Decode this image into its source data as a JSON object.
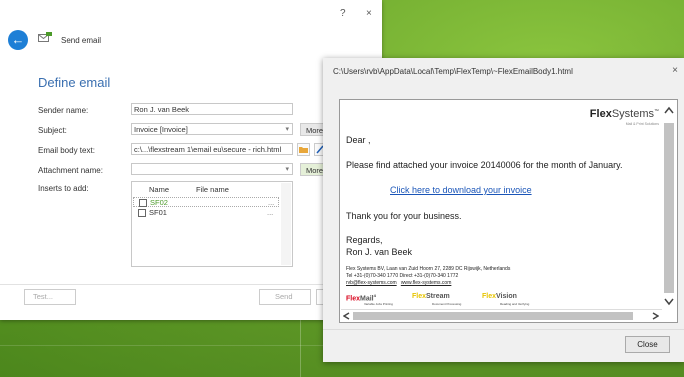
{
  "window": {
    "help": "?",
    "close": "×",
    "title": "Send email"
  },
  "form": {
    "heading": "Define email",
    "sender_label": "Sender name:",
    "sender_value": "Ron J. van Beek",
    "subject_label": "Subject:",
    "subject_value": "Invoice [Invoice]",
    "body_label": "Email body text:",
    "body_value": "c:\\...\\flexstream 1\\email eu\\secure - rich.html",
    "attach_label": "Attachment name:",
    "attach_value": "",
    "inserts_label": "Inserts to add:",
    "more_label": "More",
    "table": {
      "headers": [
        "Name",
        "File name"
      ],
      "rows": [
        {
          "name": "SF02",
          "file": "",
          "color": "#4b9a29"
        },
        {
          "name": "SF01",
          "file": "",
          "color": "#333333"
        }
      ],
      "ellipsis": "..."
    }
  },
  "footer": {
    "test": "Test...",
    "send": "Send"
  },
  "preview": {
    "title": "C:\\Users\\rvb\\AppData\\Local\\Temp\\FlexTemp\\~FlexEmailBody1.html",
    "close_x": "×",
    "logo_bold": "Flex",
    "logo_rest": "Systems",
    "logo_tm": "™",
    "logo_sub": "Mail & Print Solutions",
    "greeting": "Dear ,",
    "line1": "Please find attached your invoice 20140006 for the month of January.",
    "link": "Click here to download your invoice",
    "thanks": "Thank you for your business.",
    "regards": "Regards,",
    "signer": "Ron J. van Beek",
    "address": "Flex Systems BV, Laan van Zuid Hoorn 27, 2289 DC Rijswijk, Netherlands",
    "tel": "Tel +31-(0)70-340 1770    Direct +31-(0)70-340 1772",
    "email": "rvb@flex-systems.com",
    "web": "www.flex-systems.com",
    "brands": [
      {
        "a": "Flex",
        "b": "Mail",
        "c": "4",
        "sub": "Variable Jobs Printing"
      },
      {
        "a": "Flex",
        "b": "Stream",
        "c": "",
        "sub": "Document Processing"
      },
      {
        "a": "Flex",
        "b": "Vision",
        "c": "",
        "sub": "Reading and Verifying"
      }
    ],
    "close_button": "Close"
  },
  "colors": {
    "accent": "#1e7fd6",
    "heading": "#3a6fb0",
    "brand_red": "#d8001a",
    "brand_yellow": "#e7c400",
    "link": "#1a55b8"
  }
}
